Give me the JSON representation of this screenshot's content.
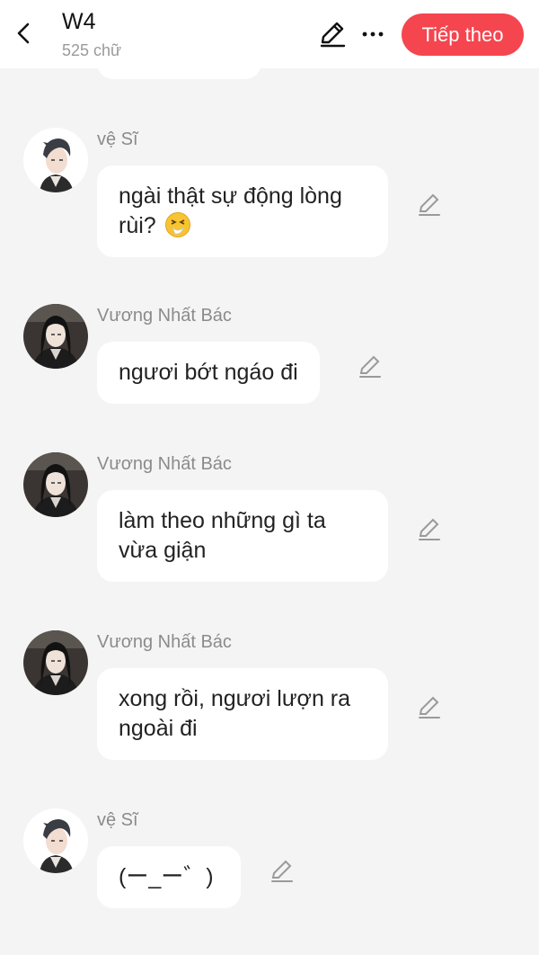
{
  "header": {
    "title": "W4",
    "subtitle": "525 chữ",
    "next_label": "Tiếp theo"
  },
  "messages": [
    {
      "sender": "vệ Sĩ",
      "text": "ngài thật sự động lòng rùi?",
      "emoji": "sneezing-face-emoji",
      "avatar": "guard-avatar"
    },
    {
      "sender": "Vương Nhất Bác",
      "text": "ngươi bớt ngáo đi",
      "avatar": "wang-yibo-avatar"
    },
    {
      "sender": "Vương Nhất Bác",
      "text": "làm theo những gì ta vừa giận",
      "avatar": "wang-yibo-avatar"
    },
    {
      "sender": "Vương Nhất Bác",
      "text": "xong rồi, ngươi lượn ra ngoài đi",
      "avatar": "wang-yibo-avatar"
    },
    {
      "sender": "vệ Sĩ",
      "text": "(ー_ー゛)",
      "avatar": "guard-avatar"
    }
  ],
  "colors": {
    "accent": "#f5454f",
    "background": "#f4f4f4",
    "bubble": "#ffffff",
    "name_text": "#8b8b8b"
  }
}
